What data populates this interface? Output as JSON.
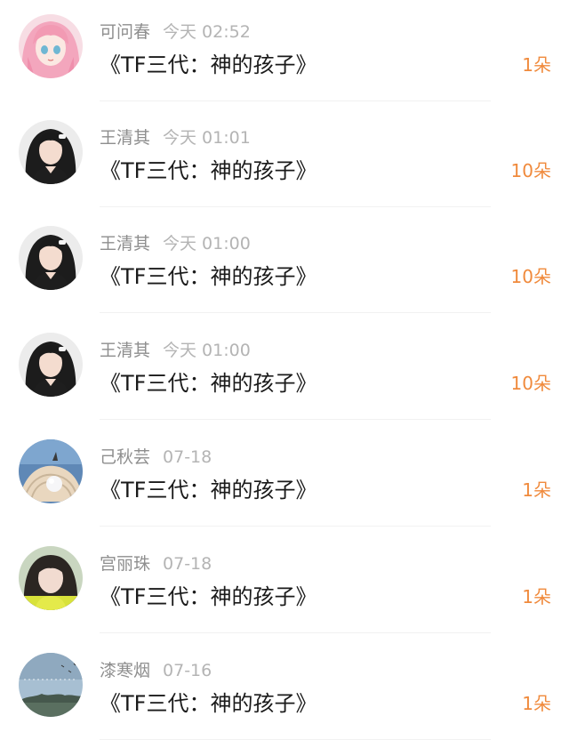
{
  "gifts": [
    {
      "name": "可问春",
      "time": "今天 02:52",
      "title": "《TF三代：神的孩子》",
      "amount": "1朵",
      "avatar": "anime-girl-avatar"
    },
    {
      "name": "王清其",
      "time": "今天 01:01",
      "title": "《TF三代：神的孩子》",
      "amount": "10朵",
      "avatar": "woman-photo-avatar"
    },
    {
      "name": "王清其",
      "time": "今天 01:00",
      "title": "《TF三代：神的孩子》",
      "amount": "10朵",
      "avatar": "woman-photo-avatar"
    },
    {
      "name": "王清其",
      "time": "今天 01:00",
      "title": "《TF三代：神的孩子》",
      "amount": "10朵",
      "avatar": "woman-photo-avatar"
    },
    {
      "name": "己秋芸",
      "time": "07-18",
      "title": "《TF三代：神的孩子》",
      "amount": "1朵",
      "avatar": "pearl-shell-avatar"
    },
    {
      "name": "宫丽珠",
      "time": "07-18",
      "title": "《TF三代：神的孩子》",
      "amount": "1朵",
      "avatar": "girl-selfie-avatar"
    },
    {
      "name": "漆寒烟",
      "time": "07-16",
      "title": "《TF三代：神的孩子》",
      "amount": "1朵",
      "avatar": "sky-landscape-avatar"
    }
  ],
  "colors": {
    "name_text": "#8e8e8e",
    "time_text": "#b4b4b4",
    "title_text": "#1a1a1a",
    "amount_accent": "#f08a3c"
  }
}
